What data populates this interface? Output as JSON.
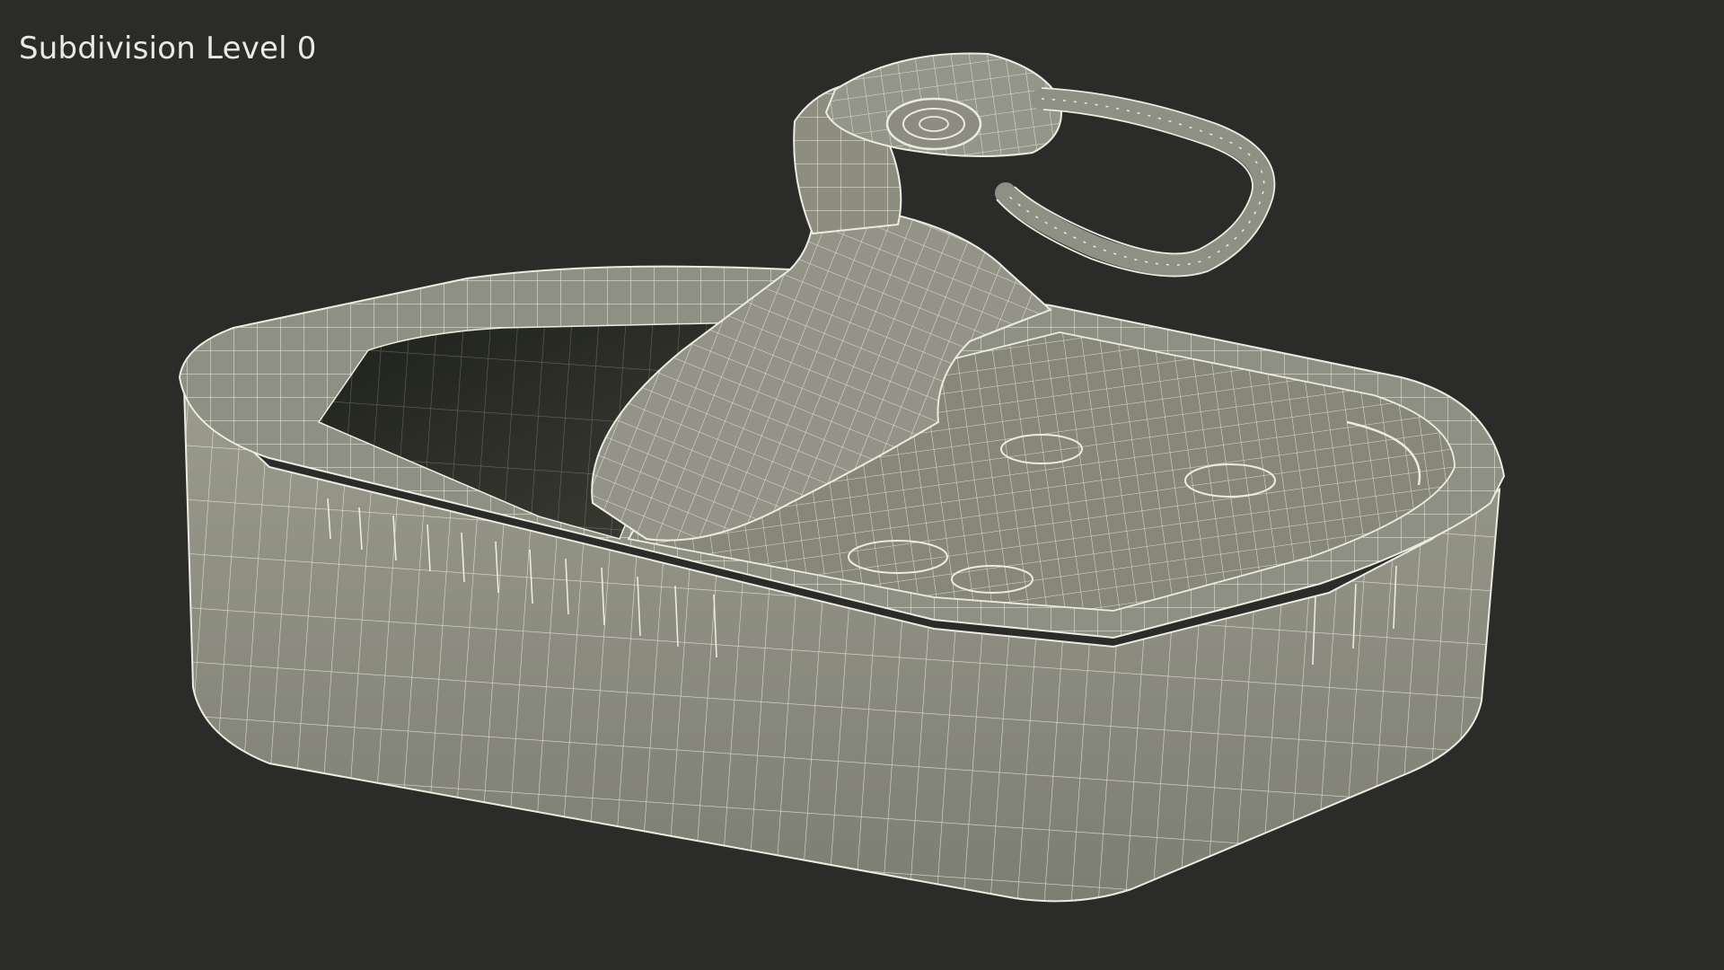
{
  "viewport": {
    "label": "Subdivision Level 0"
  },
  "colors": {
    "background": "#2b2b2a",
    "mesh_surface": "#8c8d80",
    "mesh_shadow": "#5f6056",
    "wireframe": "#ecebdf",
    "label_text": "#e9e9e6"
  },
  "scene": {
    "object": "open sardine tin with rolled-back lid and pull ring",
    "display_mode": "wireframe-on-shaded"
  }
}
